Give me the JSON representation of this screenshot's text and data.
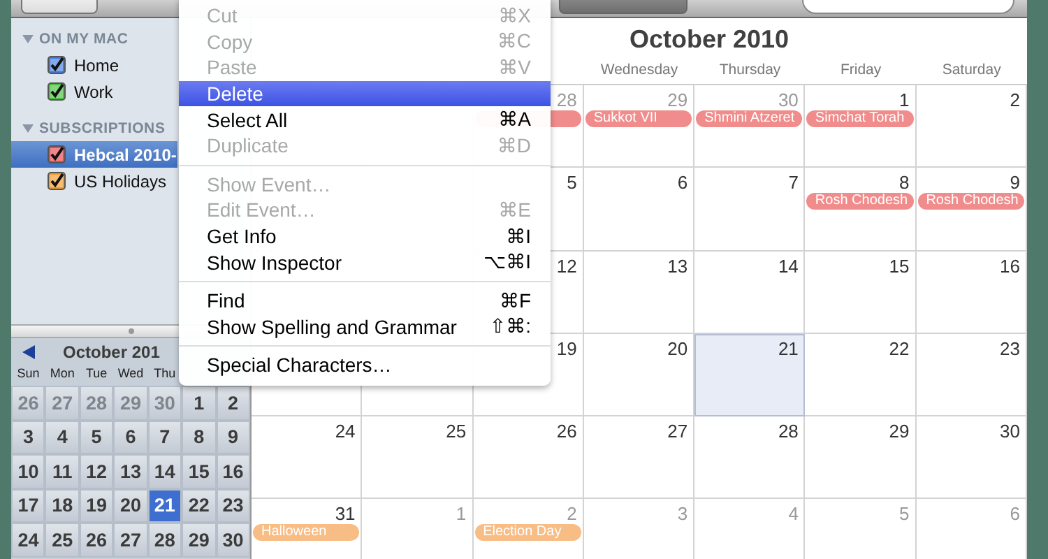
{
  "sidebar": {
    "sections": [
      {
        "title": "ON MY MAC",
        "expanded": true,
        "items": [
          {
            "label": "Home",
            "checked": true,
            "selected": false,
            "color": "#3f7be0"
          },
          {
            "label": "Work",
            "checked": true,
            "selected": false,
            "color": "#45c13c"
          }
        ]
      },
      {
        "title": "SUBSCRIPTIONS",
        "expanded": true,
        "items": [
          {
            "label": "Hebcal 2010-",
            "checked": true,
            "selected": true,
            "color": "#e9454a"
          },
          {
            "label": "US Holidays",
            "checked": true,
            "selected": false,
            "color": "#f39a2c"
          }
        ]
      }
    ]
  },
  "mini_calendar": {
    "title": "October 201",
    "weekdays": [
      "Sun",
      "Mon",
      "Tue",
      "Wed",
      "Thu"
    ],
    "weeks": [
      [
        {
          "day": "26",
          "in_month": false,
          "selected": false
        },
        {
          "day": "27",
          "in_month": false,
          "selected": false
        },
        {
          "day": "28",
          "in_month": false,
          "selected": false
        },
        {
          "day": "29",
          "in_month": false,
          "selected": false
        },
        {
          "day": "30",
          "in_month": false,
          "selected": false
        },
        {
          "day": "1",
          "in_month": true,
          "selected": false
        },
        {
          "day": "2",
          "in_month": true,
          "selected": false
        }
      ],
      [
        {
          "day": "3",
          "in_month": true,
          "selected": false
        },
        {
          "day": "4",
          "in_month": true,
          "selected": false
        },
        {
          "day": "5",
          "in_month": true,
          "selected": false
        },
        {
          "day": "6",
          "in_month": true,
          "selected": false
        },
        {
          "day": "7",
          "in_month": true,
          "selected": false
        },
        {
          "day": "8",
          "in_month": true,
          "selected": false
        },
        {
          "day": "9",
          "in_month": true,
          "selected": false
        }
      ],
      [
        {
          "day": "10",
          "in_month": true,
          "selected": false
        },
        {
          "day": "11",
          "in_month": true,
          "selected": false
        },
        {
          "day": "12",
          "in_month": true,
          "selected": false
        },
        {
          "day": "13",
          "in_month": true,
          "selected": false
        },
        {
          "day": "14",
          "in_month": true,
          "selected": false
        },
        {
          "day": "15",
          "in_month": true,
          "selected": false
        },
        {
          "day": "16",
          "in_month": true,
          "selected": false
        }
      ],
      [
        {
          "day": "17",
          "in_month": true,
          "selected": false
        },
        {
          "day": "18",
          "in_month": true,
          "selected": false
        },
        {
          "day": "19",
          "in_month": true,
          "selected": false
        },
        {
          "day": "20",
          "in_month": true,
          "selected": false
        },
        {
          "day": "21",
          "in_month": true,
          "selected": true
        },
        {
          "day": "22",
          "in_month": true,
          "selected": false
        },
        {
          "day": "23",
          "in_month": true,
          "selected": false
        }
      ],
      [
        {
          "day": "24",
          "in_month": true,
          "selected": false
        },
        {
          "day": "25",
          "in_month": true,
          "selected": false
        },
        {
          "day": "26",
          "in_month": true,
          "selected": false
        },
        {
          "day": "27",
          "in_month": true,
          "selected": false
        },
        {
          "day": "28",
          "in_month": true,
          "selected": false
        },
        {
          "day": "29",
          "in_month": true,
          "selected": false
        },
        {
          "day": "30",
          "in_month": true,
          "selected": false
        }
      ]
    ]
  },
  "calendar": {
    "title": "October 2010",
    "weekdays": [
      "Wednesday",
      "Thursday",
      "Friday",
      "Saturday"
    ],
    "weeks": [
      [
        {
          "day": "28",
          "in_month": false,
          "today": false,
          "events": [
            {
              "color": "#f08c8c"
            }
          ]
        },
        {
          "day": "29",
          "in_month": false,
          "today": false,
          "events": [
            {
              "title": "Sukkot VII",
              "color": "#f08c8c"
            }
          ]
        },
        {
          "day": "30",
          "in_month": false,
          "today": false,
          "events": [
            {
              "title": "Shmini Atzeret",
              "color": "#f08c8c"
            }
          ]
        },
        {
          "day": "1",
          "in_month": true,
          "today": false,
          "events": [
            {
              "title": "Simchat Torah",
              "color": "#f08c8c"
            }
          ]
        },
        {
          "day": "2",
          "in_month": true,
          "today": false
        }
      ],
      [
        {
          "day": "5",
          "in_month": true,
          "today": false
        },
        {
          "day": "6",
          "in_month": true,
          "today": false
        },
        {
          "day": "7",
          "in_month": true,
          "today": false
        },
        {
          "day": "8",
          "in_month": true,
          "today": false,
          "events": [
            {
              "title": "Rosh Chodesh",
              "color": "#f08c8c"
            }
          ]
        },
        {
          "day": "9",
          "in_month": true,
          "today": false,
          "events": [
            {
              "title": "Rosh Chodesh",
              "color": "#f08c8c"
            }
          ]
        }
      ],
      [
        {
          "day": "12",
          "in_month": true,
          "today": false
        },
        {
          "day": "13",
          "in_month": true,
          "today": false
        },
        {
          "day": "14",
          "in_month": true,
          "today": false
        },
        {
          "day": "15",
          "in_month": true,
          "today": false
        },
        {
          "day": "16",
          "in_month": true,
          "today": false
        }
      ],
      [
        {
          "day": "19",
          "in_month": true,
          "today": false
        },
        {
          "day": "20",
          "in_month": true,
          "today": false
        },
        {
          "day": "21",
          "in_month": true,
          "today": true
        },
        {
          "day": "22",
          "in_month": true,
          "today": false
        },
        {
          "day": "23",
          "in_month": true,
          "today": false
        }
      ],
      [
        {
          "day": "24",
          "in_month": true,
          "today": false
        },
        {
          "day": "25",
          "in_month": true,
          "today": false
        },
        {
          "day": "26",
          "in_month": true,
          "today": false
        },
        {
          "day": "27",
          "in_month": true,
          "today": false
        },
        {
          "day": "28",
          "in_month": true,
          "today": false
        },
        {
          "day": "29",
          "in_month": true,
          "today": false
        },
        {
          "day": "30",
          "in_month": true,
          "today": false
        }
      ],
      [
        {
          "day": "31",
          "in_month": true,
          "today": false,
          "events": [
            {
              "title": "Halloween",
              "color": "#f8bd85"
            }
          ]
        },
        {
          "day": "1",
          "in_month": false,
          "today": false
        },
        {
          "day": "2",
          "in_month": false,
          "today": false,
          "events": [
            {
              "title": "Election Day",
              "color": "#f8bd85"
            }
          ]
        },
        {
          "day": "3",
          "in_month": false,
          "today": false
        },
        {
          "day": "4",
          "in_month": false,
          "today": false
        },
        {
          "day": "5",
          "in_month": false,
          "today": false
        },
        {
          "day": "6",
          "in_month": false,
          "today": false
        }
      ]
    ]
  },
  "context_menu": {
    "groups": [
      [
        {
          "label": "Cut",
          "shortcut": "⌘X",
          "disabled": true,
          "highlighted": false
        },
        {
          "label": "Copy",
          "shortcut": "⌘C",
          "disabled": true,
          "highlighted": false
        },
        {
          "label": "Paste",
          "shortcut": "⌘V",
          "disabled": true,
          "highlighted": false
        },
        {
          "label": "Delete",
          "disabled": false,
          "highlighted": true
        },
        {
          "label": "Select All",
          "shortcut": "⌘A",
          "disabled": false,
          "highlighted": false
        },
        {
          "label": "Duplicate",
          "shortcut": "⌘D",
          "disabled": true,
          "highlighted": false
        }
      ],
      [
        {
          "label": "Show Event…",
          "disabled": true,
          "highlighted": false
        },
        {
          "label": "Edit Event…",
          "shortcut": "⌘E",
          "disabled": true,
          "highlighted": false
        },
        {
          "label": "Get Info",
          "shortcut": "⌘I",
          "disabled": false,
          "highlighted": false
        },
        {
          "label": "Show Inspector",
          "shortcut": "⌥⌘I",
          "disabled": false,
          "highlighted": false
        }
      ],
      [
        {
          "label": "Find",
          "shortcut": "⌘F",
          "disabled": false,
          "highlighted": false
        },
        {
          "label": "Show Spelling and Grammar",
          "shortcut": "⇧⌘:",
          "disabled": false,
          "highlighted": false
        }
      ],
      [
        {
          "label": "Special Characters…",
          "disabled": false,
          "highlighted": false
        }
      ]
    ]
  }
}
